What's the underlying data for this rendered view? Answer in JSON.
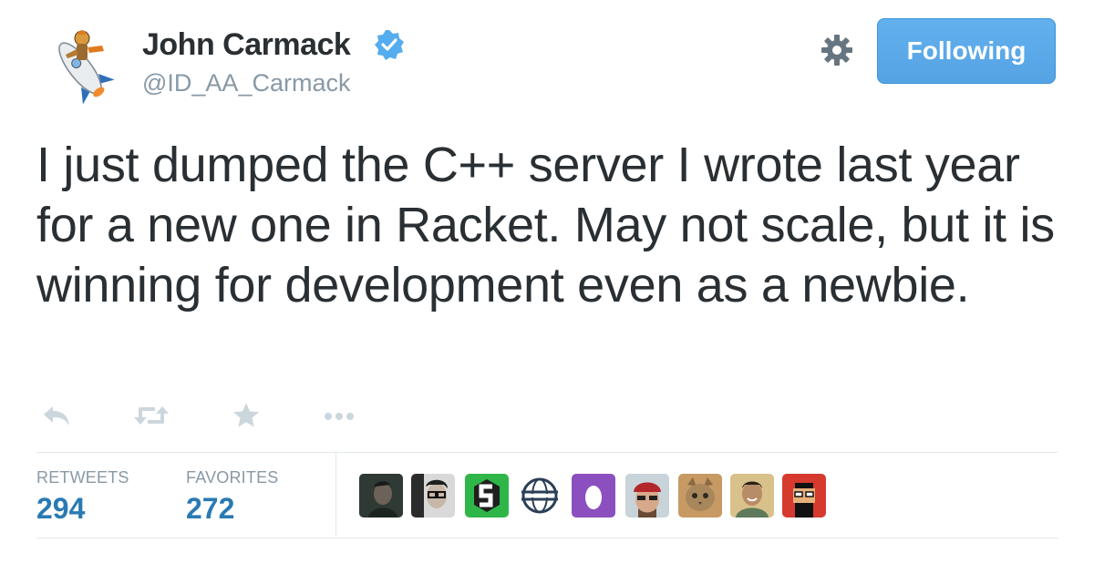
{
  "user": {
    "display_name": "John Carmack",
    "screen_name": "@ID_AA_Carmack",
    "verified": true,
    "avatar_icon": "rocket-rider-avatar"
  },
  "header": {
    "settings_icon": "gear-icon",
    "follow_label": "Following"
  },
  "tweet": {
    "text": "I just dumped the C++ server I wrote last year for a new one in Racket. May not scale, but it is winning for development even as a newbie."
  },
  "actions": [
    {
      "name": "reply",
      "icon": "reply-arrow-icon"
    },
    {
      "name": "retweet",
      "icon": "retweet-icon"
    },
    {
      "name": "favorite",
      "icon": "star-icon"
    },
    {
      "name": "more",
      "icon": "ellipsis-icon"
    }
  ],
  "stats": {
    "retweets_label": "RETWEETS",
    "retweets_count": "294",
    "favorites_label": "FAVORITES",
    "favorites_count": "272"
  },
  "favoriters": [
    {
      "icon": "dark-portrait-avatar"
    },
    {
      "icon": "glasses-portrait-avatar"
    },
    {
      "icon": "green-logo-avatar"
    },
    {
      "icon": "globe-logo-avatar"
    },
    {
      "icon": "purple-egg-avatar"
    },
    {
      "icon": "bandana-portrait-avatar"
    },
    {
      "icon": "cat-avatar"
    },
    {
      "icon": "smiling-portrait-avatar"
    },
    {
      "icon": "pixel-art-avatar"
    }
  ],
  "colors": {
    "accent_blue": "#55acee",
    "count_blue": "#2a7ab3",
    "muted_gray": "#8899a6",
    "text": "#292f33",
    "divider": "#e1e8ed"
  }
}
